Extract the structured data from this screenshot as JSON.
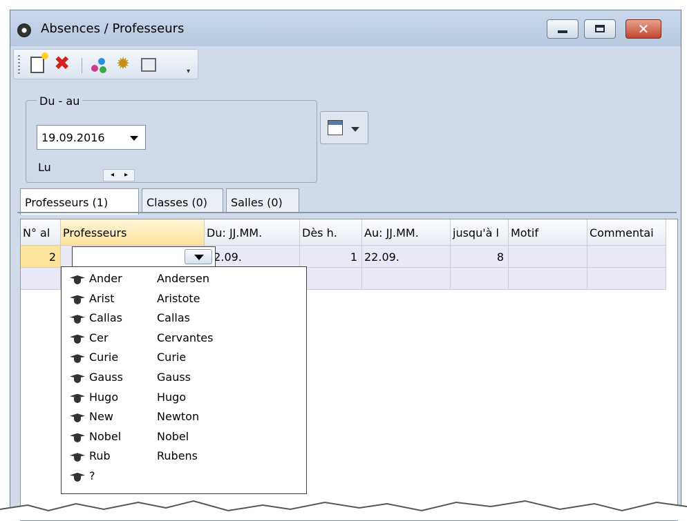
{
  "window": {
    "title": "Absences / Professeurs",
    "controls": {
      "minimize": "minimize",
      "maximize": "maximize",
      "close": "✕"
    }
  },
  "toolbar": {
    "icons": [
      "new-icon",
      "delete-icon",
      "people-icon",
      "settings-icon",
      "list-icon"
    ]
  },
  "period": {
    "group_label": "Du - au",
    "date_value": "19.09.2016",
    "day_label": "Lu"
  },
  "tabs": [
    {
      "label": "Professeurs (1)",
      "active": true
    },
    {
      "label": "Classes (0)",
      "active": false
    },
    {
      "label": "Salles (0)",
      "active": false
    }
  ],
  "grid": {
    "columns": [
      "N° al",
      "Professeurs",
      "Du: JJ.MM.",
      "Dès h.",
      "Au: JJ.MM.",
      "jusqu'à l",
      "Motif",
      "Commentai"
    ],
    "rows": [
      {
        "no": "2",
        "professeur": "",
        "du": "22.09.",
        "des_h": "1",
        "au": "22.09.",
        "jusqua": "8",
        "motif": "",
        "commentaire": ""
      }
    ]
  },
  "dropdown": {
    "items": [
      {
        "short": "Ander",
        "long": "Andersen"
      },
      {
        "short": "Arist",
        "long": "Aristote"
      },
      {
        "short": "Callas",
        "long": "Callas"
      },
      {
        "short": "Cer",
        "long": "Cervantes"
      },
      {
        "short": "Curie",
        "long": "Curie"
      },
      {
        "short": "Gauss",
        "long": "Gauss"
      },
      {
        "short": "Hugo",
        "long": "Hugo"
      },
      {
        "short": "New",
        "long": "Newton"
      },
      {
        "short": "Nobel",
        "long": "Nobel"
      },
      {
        "short": "Rub",
        "long": "Rubens"
      },
      {
        "short": "?",
        "long": ""
      }
    ]
  },
  "colors": {
    "window_bg": "#d1dae8",
    "row_bg": "#e8e8f6",
    "header_selected": "#fde39b",
    "close_button": "#c0452b"
  }
}
